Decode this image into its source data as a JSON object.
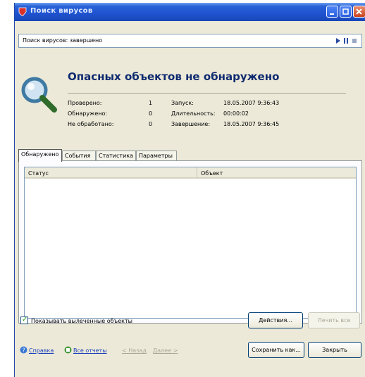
{
  "window": {
    "title": "Поиск вирусов"
  },
  "status_bar": {
    "text": "Поиск вирусов: завершено"
  },
  "summary": {
    "headline": "Опасных объектов не обнаружено",
    "checked_label": "Проверено:",
    "checked_value": "1",
    "detected_label": "Обнаружено:",
    "detected_value": "0",
    "unprocessed_label": "Не обработано:",
    "unprocessed_value": "0",
    "started_label": "Запуск:",
    "started_value": "18.05.2007 9:36:43",
    "duration_label": "Длительность:",
    "duration_value": "00:00:02",
    "finished_label": "Завершение:",
    "finished_value": "18.05.2007 9:36:45"
  },
  "tabs": [
    {
      "label": "Обнаружено",
      "active": true
    },
    {
      "label": "События",
      "active": false
    },
    {
      "label": "Статистика",
      "active": false
    },
    {
      "label": "Параметры",
      "active": false
    }
  ],
  "table": {
    "columns": [
      "Статус",
      "Объект"
    ],
    "rows": []
  },
  "checkbox": {
    "label": "Показывать вылеченные объекты",
    "checked": true
  },
  "buttons": {
    "actions": "Действия...",
    "cure_all": "Лечить все",
    "save_as": "Сохранить как...",
    "close": "Закрыть"
  },
  "footer": {
    "help": "Справка",
    "all_reports": "Все отчеты",
    "back": "< Назад",
    "next": "Далее >"
  },
  "colors": {
    "titlebar": "#2a63d8",
    "window_bg": "#ece9d8",
    "headline": "#0e2a6f",
    "link": "#1a3fbb"
  }
}
